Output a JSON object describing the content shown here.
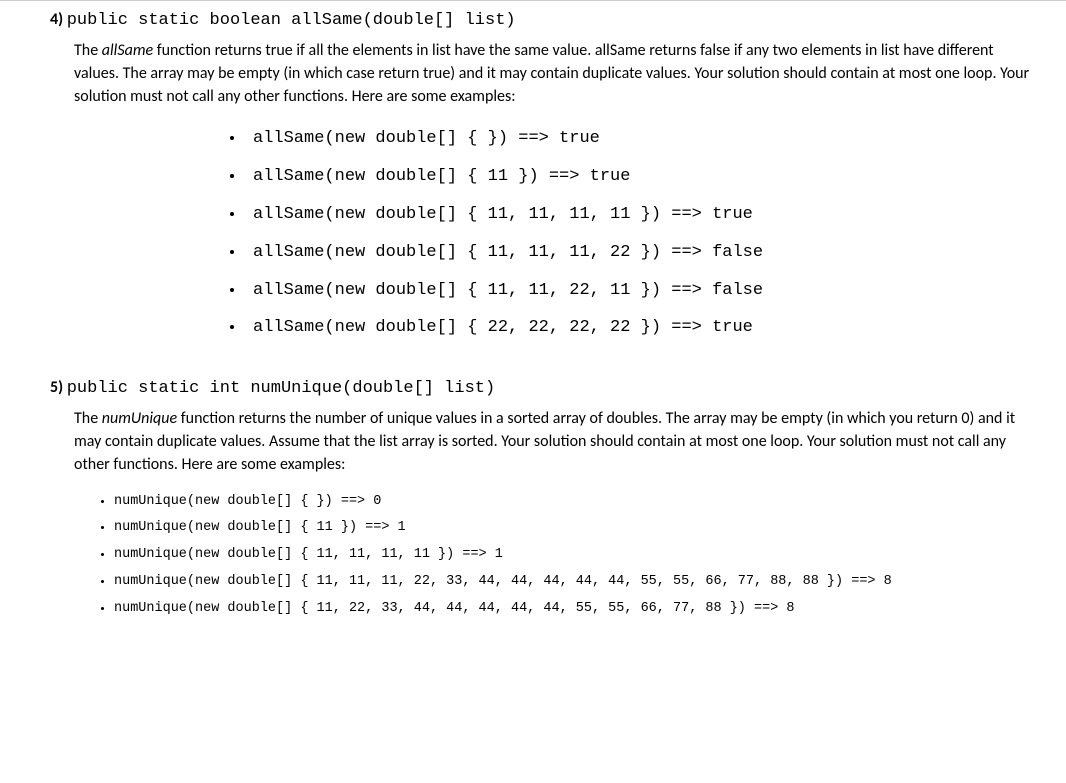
{
  "q4": {
    "number": "4)",
    "signature": "public static boolean allSame(double[] list)",
    "desc_pre": "The ",
    "func_name": "allSame",
    "desc_post": " function returns true if all the elements in list have the same value. allSame returns false if any two elements in list have different values. The array may be empty (in which case return true) and it may contain duplicate values. Your solution should contain at most one loop. Your solution must not call any other functions. Here are some examples:",
    "examples": [
      "allSame(new double[] { }) ==> true",
      "allSame(new double[] { 11 }) ==> true",
      "allSame(new double[] { 11, 11, 11, 11 }) ==> true",
      "allSame(new double[] { 11, 11, 11, 22 }) ==> false",
      "allSame(new double[] { 11, 11, 22, 11 }) ==> false",
      "allSame(new double[] { 22, 22, 22, 22 }) ==> true"
    ]
  },
  "q5": {
    "number": "5)",
    "signature": "public static int numUnique(double[] list)",
    "desc_pre": "The ",
    "func_name": "numUnique",
    "desc_post": " function returns the number of unique values in a sorted array of doubles. The array may be empty (in which you return 0) and it may contain duplicate values. Assume that the list array is sorted. Your solution should contain at most one loop. Your solution must not call any other functions. Here are some examples:",
    "examples": [
      "numUnique(new double[] { }) ==> 0",
      "numUnique(new double[] { 11 }) ==> 1",
      "numUnique(new double[] { 11, 11, 11, 11 }) ==> 1",
      "numUnique(new double[] { 11, 11, 11, 22, 33, 44, 44, 44, 44, 44, 55, 55, 66, 77, 88, 88 }) ==> 8",
      "numUnique(new double[] { 11, 22, 33, 44, 44, 44, 44, 44, 55, 55, 66, 77, 88 }) ==> 8"
    ]
  }
}
